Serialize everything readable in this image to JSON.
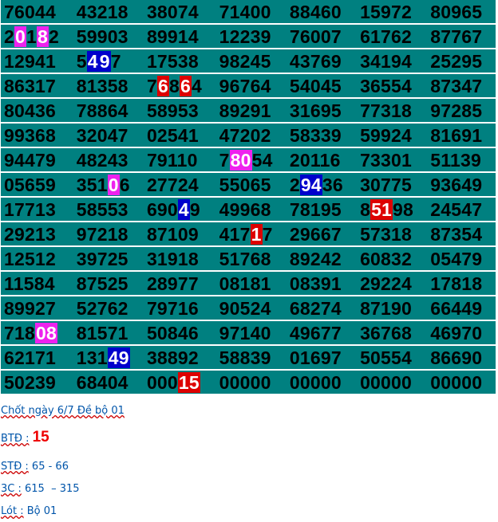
{
  "colors": {
    "cell_bg": "#008080",
    "magenta": "#ee22ee",
    "blue": "#0000cc",
    "red": "#dd0000",
    "note_text": "#0055aa",
    "btd_value": "#ee0000"
  },
  "grid": [
    [
      [
        {
          "t": "76044"
        }
      ],
      [
        {
          "t": "43218"
        }
      ],
      [
        {
          "t": "38074"
        }
      ],
      [
        {
          "t": "71400"
        }
      ],
      [
        {
          "t": "88460"
        }
      ],
      [
        {
          "t": "15972"
        }
      ],
      [
        {
          "t": "80965"
        }
      ]
    ],
    [
      [
        {
          "t": "2"
        },
        {
          "t": "0",
          "c": "magenta"
        },
        {
          "t": "1"
        },
        {
          "t": "8",
          "c": "magenta"
        },
        {
          "t": "2"
        }
      ],
      [
        {
          "t": "59903"
        }
      ],
      [
        {
          "t": "89914"
        }
      ],
      [
        {
          "t": "12239"
        }
      ],
      [
        {
          "t": "76007"
        }
      ],
      [
        {
          "t": "61762"
        }
      ],
      [
        {
          "t": "87767"
        }
      ]
    ],
    [
      [
        {
          "t": "12941"
        }
      ],
      [
        {
          "t": "5"
        },
        {
          "t": "4",
          "c": "blue"
        },
        {
          "t": "9",
          "c": "blue"
        },
        {
          "t": "7"
        }
      ],
      [
        {
          "t": "17538"
        }
      ],
      [
        {
          "t": "98245"
        }
      ],
      [
        {
          "t": "43769"
        }
      ],
      [
        {
          "t": "34194"
        }
      ],
      [
        {
          "t": "25295"
        }
      ]
    ],
    [
      [
        {
          "t": "86317"
        }
      ],
      [
        {
          "t": "81358"
        }
      ],
      [
        {
          "t": "7"
        },
        {
          "t": "6",
          "c": "red"
        },
        {
          "t": "8"
        },
        {
          "t": "6",
          "c": "red"
        },
        {
          "t": "4"
        }
      ],
      [
        {
          "t": "96764"
        }
      ],
      [
        {
          "t": "54045"
        }
      ],
      [
        {
          "t": "36554"
        }
      ],
      [
        {
          "t": "87347"
        }
      ]
    ],
    [
      [
        {
          "t": "80436"
        }
      ],
      [
        {
          "t": "78864"
        }
      ],
      [
        {
          "t": "58953"
        }
      ],
      [
        {
          "t": "89291"
        }
      ],
      [
        {
          "t": "31695"
        }
      ],
      [
        {
          "t": "77318"
        }
      ],
      [
        {
          "t": "97285"
        }
      ]
    ],
    [
      [
        {
          "t": "99368"
        }
      ],
      [
        {
          "t": "32047"
        }
      ],
      [
        {
          "t": "02541"
        }
      ],
      [
        {
          "t": "47202"
        }
      ],
      [
        {
          "t": "58339"
        }
      ],
      [
        {
          "t": "59924"
        }
      ],
      [
        {
          "t": "81691"
        }
      ]
    ],
    [
      [
        {
          "t": "94479"
        }
      ],
      [
        {
          "t": "48243"
        }
      ],
      [
        {
          "t": "79110"
        }
      ],
      [
        {
          "t": "7"
        },
        {
          "t": "80",
          "c": "magenta"
        },
        {
          "t": "54"
        }
      ],
      [
        {
          "t": "20116"
        }
      ],
      [
        {
          "t": "73301"
        }
      ],
      [
        {
          "t": "51139"
        }
      ]
    ],
    [
      [
        {
          "t": "05659"
        }
      ],
      [
        {
          "t": "351"
        },
        {
          "t": "0",
          "c": "magenta"
        },
        {
          "t": "6"
        }
      ],
      [
        {
          "t": "27724"
        }
      ],
      [
        {
          "t": "55065"
        }
      ],
      [
        {
          "t": "2"
        },
        {
          "t": "94",
          "c": "blue"
        },
        {
          "t": "36"
        }
      ],
      [
        {
          "t": "30775"
        }
      ],
      [
        {
          "t": "93649"
        }
      ]
    ],
    [
      [
        {
          "t": "17713"
        }
      ],
      [
        {
          "t": "58553"
        }
      ],
      [
        {
          "t": "690"
        },
        {
          "t": "4",
          "c": "blue"
        },
        {
          "t": "9"
        }
      ],
      [
        {
          "t": "49968"
        }
      ],
      [
        {
          "t": "78195"
        }
      ],
      [
        {
          "t": "8"
        },
        {
          "t": "51",
          "c": "red"
        },
        {
          "t": "98"
        }
      ],
      [
        {
          "t": "24547"
        }
      ]
    ],
    [
      [
        {
          "t": "29213"
        }
      ],
      [
        {
          "t": "97218"
        }
      ],
      [
        {
          "t": "87109"
        }
      ],
      [
        {
          "t": "417"
        },
        {
          "t": "1",
          "c": "red"
        },
        {
          "t": "7"
        }
      ],
      [
        {
          "t": "29667"
        }
      ],
      [
        {
          "t": "57318"
        }
      ],
      [
        {
          "t": "87354"
        }
      ]
    ],
    [
      [
        {
          "t": "12512"
        }
      ],
      [
        {
          "t": "39725"
        }
      ],
      [
        {
          "t": "31918"
        }
      ],
      [
        {
          "t": "51768"
        }
      ],
      [
        {
          "t": "89242"
        }
      ],
      [
        {
          "t": "60832"
        }
      ],
      [
        {
          "t": "05479"
        }
      ]
    ],
    [
      [
        {
          "t": "11584"
        }
      ],
      [
        {
          "t": "87525"
        }
      ],
      [
        {
          "t": "28977"
        }
      ],
      [
        {
          "t": "08181"
        }
      ],
      [
        {
          "t": "08391"
        }
      ],
      [
        {
          "t": "29224"
        }
      ],
      [
        {
          "t": "17818"
        }
      ]
    ],
    [
      [
        {
          "t": "89927"
        }
      ],
      [
        {
          "t": "52762"
        }
      ],
      [
        {
          "t": "79716"
        }
      ],
      [
        {
          "t": "90524"
        }
      ],
      [
        {
          "t": "68274"
        }
      ],
      [
        {
          "t": "87190"
        }
      ],
      [
        {
          "t": "66449"
        }
      ]
    ],
    [
      [
        {
          "t": "718"
        },
        {
          "t": "08",
          "c": "magenta"
        }
      ],
      [
        {
          "t": "81571"
        }
      ],
      [
        {
          "t": "50846"
        }
      ],
      [
        {
          "t": "97140"
        }
      ],
      [
        {
          "t": "49677"
        }
      ],
      [
        {
          "t": "36768"
        }
      ],
      [
        {
          "t": "46970"
        }
      ]
    ],
    [
      [
        {
          "t": "62171"
        }
      ],
      [
        {
          "t": "131"
        },
        {
          "t": "49",
          "c": "blue"
        }
      ],
      [
        {
          "t": "38892"
        }
      ],
      [
        {
          "t": "58839"
        }
      ],
      [
        {
          "t": "01697"
        }
      ],
      [
        {
          "t": "50554"
        }
      ],
      [
        {
          "t": "86690"
        }
      ]
    ],
    [
      [
        {
          "t": "50239"
        }
      ],
      [
        {
          "t": "68404"
        }
      ],
      [
        {
          "t": "000"
        },
        {
          "t": "15",
          "c": "red"
        }
      ],
      [
        {
          "t": "00000"
        }
      ],
      [
        {
          "t": "00000"
        }
      ],
      [
        {
          "t": "00000"
        }
      ],
      [
        {
          "t": "00000"
        }
      ]
    ]
  ],
  "notes": {
    "chot": "Chốt ngày 6/7 Đề bộ 01",
    "btd_label": "BTĐ :",
    "btd_value": "15",
    "std_label": "STĐ :",
    "std_value": "65 - 66",
    "bac_label": "3C :",
    "bac_value": "615  – 315",
    "lot_label": "Lót :",
    "lot_value": "Bộ 01"
  }
}
